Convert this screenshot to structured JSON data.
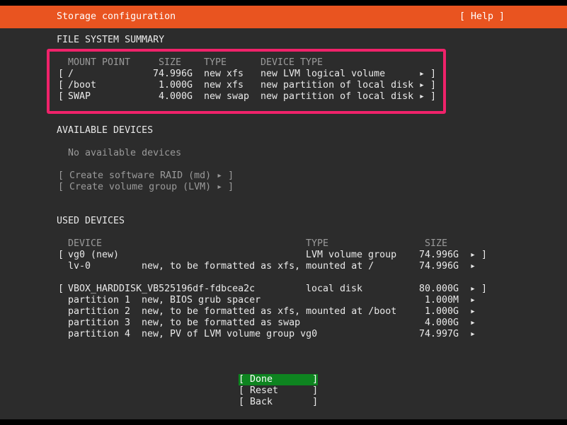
{
  "header": {
    "title": "Storage configuration",
    "help": "[ Help ]"
  },
  "fs_summary": {
    "title": "FILE SYSTEM SUMMARY",
    "columns": [
      "MOUNT POINT",
      "SIZE",
      "TYPE",
      "DEVICE TYPE"
    ],
    "rows": [
      {
        "bracket": "[",
        "mount": "/",
        "size": "74.996G",
        "type": "new xfs",
        "device_type": "new LVM logical volume",
        "arrow": "▸ ]"
      },
      {
        "bracket": "[",
        "mount": "/boot",
        "size": "1.000G",
        "type": "new xfs",
        "device_type": "new partition of local disk",
        "arrow": "▸ ]"
      },
      {
        "bracket": "[",
        "mount": "SWAP",
        "size": "4.000G",
        "type": "new swap",
        "device_type": "new partition of local disk",
        "arrow": "▸ ]"
      }
    ]
  },
  "available": {
    "title": "AVAILABLE DEVICES",
    "empty": "No available devices",
    "actions": [
      "[ Create software RAID (md) ▸ ]",
      "[ Create volume group (LVM) ▸ ]"
    ]
  },
  "used": {
    "title": "USED DEVICES",
    "columns": [
      "DEVICE",
      "TYPE",
      "SIZE"
    ],
    "groups": [
      {
        "bracket": "[",
        "device": "vg0 (new)",
        "type": "LVM volume group",
        "size": "74.996G",
        "arrow": "▸ ]",
        "children": [
          {
            "device": "lv-0",
            "desc": "new, to be formatted as xfs, mounted at /",
            "size": "74.996G",
            "arrow": "▸"
          }
        ]
      },
      {
        "bracket": "[",
        "device": "VBOX_HARDDISK_VB525196df-fdbcea2c",
        "type": "local disk",
        "size": "80.000G",
        "arrow": "▸ ]",
        "children": [
          {
            "device": "partition 1",
            "desc": "new, BIOS grub spacer",
            "size": "1.000M",
            "arrow": "▸"
          },
          {
            "device": "partition 2",
            "desc": "new, to be formatted as xfs, mounted at /boot",
            "size": "1.000G",
            "arrow": "▸"
          },
          {
            "device": "partition 3",
            "desc": "new, to be formatted as swap",
            "size": "4.000G",
            "arrow": "▸"
          },
          {
            "device": "partition 4",
            "desc": "new, PV of LVM volume group vg0",
            "size": "74.997G",
            "arrow": "▸"
          }
        ]
      }
    ]
  },
  "buttons": {
    "done": "[ Done       ]",
    "reset": "[ Reset      ]",
    "back": "[ Back       ]"
  },
  "colors": {
    "accent": "#e95420",
    "highlight": "#f0226a",
    "done_bg": "#0e8420"
  }
}
